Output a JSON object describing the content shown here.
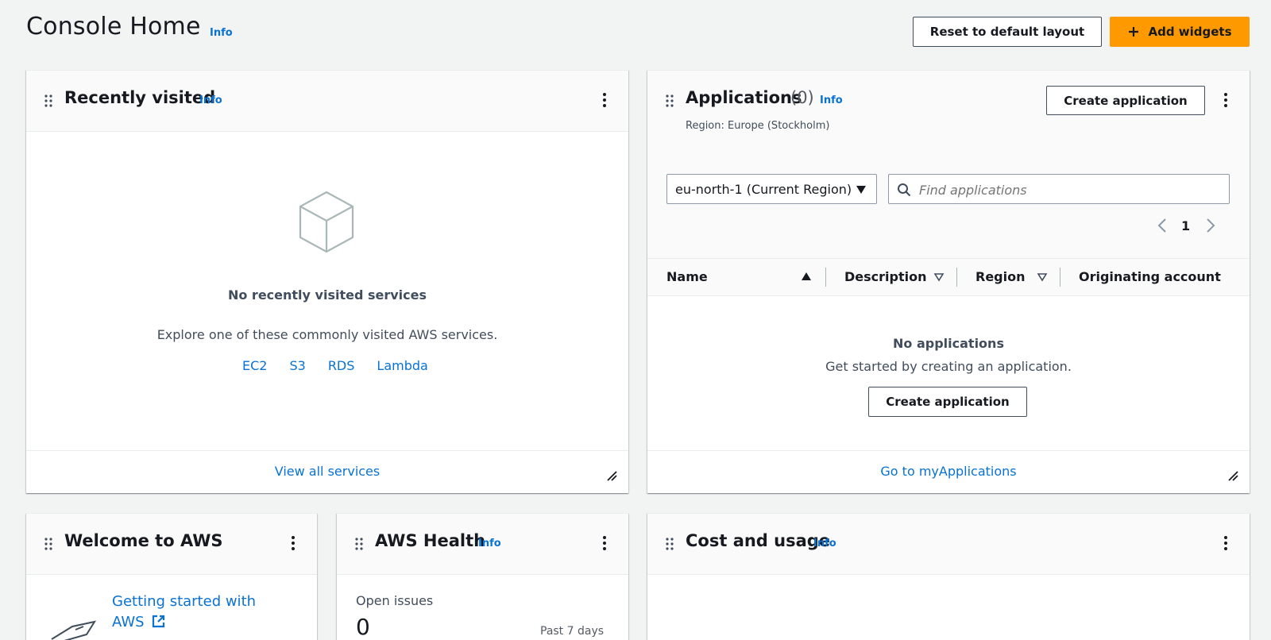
{
  "header": {
    "title": "Console Home",
    "info": "Info",
    "reset_label": "Reset to default layout",
    "add_widgets_label": "Add widgets",
    "add_icon": "plus-icon"
  },
  "recently_visited": {
    "title": "Recently visited",
    "info": "Info",
    "empty_title": "No recently visited services",
    "explore_text": "Explore one of these commonly visited AWS services.",
    "services": [
      "EC2",
      "S3",
      "RDS",
      "Lambda"
    ],
    "footer_link": "View all services"
  },
  "applications": {
    "title": "Applications",
    "count": "(0)",
    "info": "Info",
    "region_text": "Region: Europe (Stockholm)",
    "create_label": "Create application",
    "region_select": "eu-north-1 (Current Region)",
    "search_placeholder": "Find applications",
    "page_number": "1",
    "columns": [
      "Name",
      "Description",
      "Region",
      "Originating account"
    ],
    "empty_title": "No applications",
    "empty_text": "Get started by creating an application.",
    "empty_create_label": "Create application",
    "footer_link": "Go to myApplications"
  },
  "welcome": {
    "title": "Welcome to AWS",
    "link_line1": "Getting started with",
    "link_line2": "AWS"
  },
  "health": {
    "title": "AWS Health",
    "info": "Info",
    "open_issues_label": "Open issues",
    "open_issues_value": "0",
    "period": "Past 7 days"
  },
  "cost": {
    "title": "Cost and usage",
    "info": "Info"
  },
  "colors": {
    "accent": "#ff9900",
    "link": "#0972d3",
    "background": "#f2f3f3"
  }
}
